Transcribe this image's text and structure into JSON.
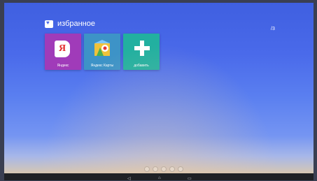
{
  "section": {
    "title": "избранное",
    "icon": "folder-heart-icon"
  },
  "page_indicator": "/3",
  "tiles": [
    {
      "label": "Яндекс",
      "icon": "yandex-browser-icon",
      "color": "#a03bb9"
    },
    {
      "label": "Яндекс Карты",
      "icon": "yandex-maps-icon",
      "color": "#3d93c7"
    },
    {
      "label": "добавить",
      "icon": "plus-icon",
      "color": "#22b0a0"
    }
  ],
  "dock_icons": [
    "settings-icon",
    "apps-icon",
    "media-icon",
    "record-icon",
    "power-icon"
  ],
  "navbar": {
    "back": "back-icon",
    "home": "home-icon",
    "recents": "recents-icon"
  }
}
